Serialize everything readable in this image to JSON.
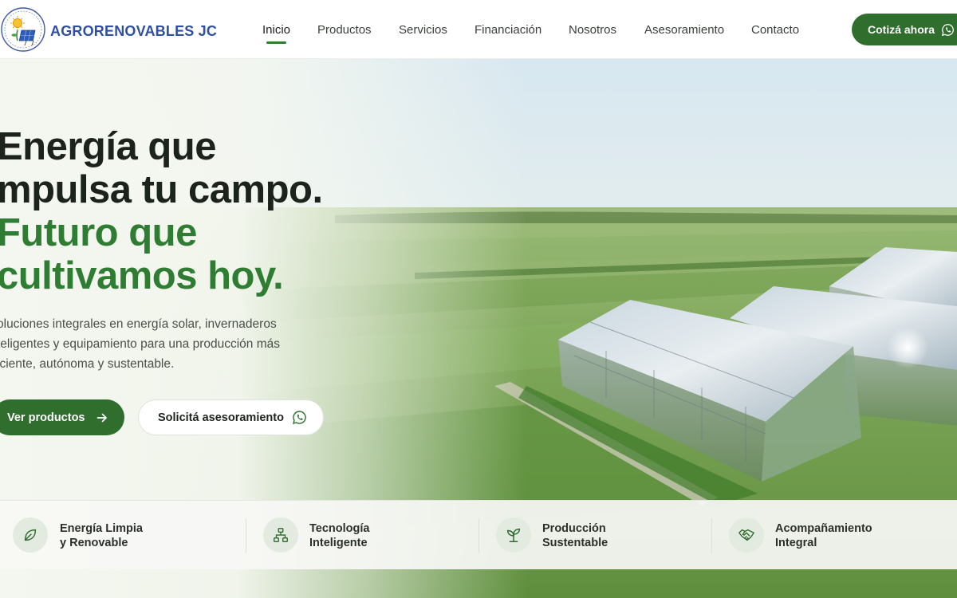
{
  "brand": {
    "name": "AGRORENOVABLES JC"
  },
  "nav": {
    "items": [
      {
        "label": "Inicio",
        "active": true
      },
      {
        "label": "Productos"
      },
      {
        "label": "Servicios"
      },
      {
        "label": "Financiación"
      },
      {
        "label": "Nosotros"
      },
      {
        "label": "Asesoramiento"
      },
      {
        "label": "Contacto"
      }
    ],
    "cta_label": "Cotizá ahora",
    "cta_icon": "whatsapp-icon"
  },
  "hero": {
    "headline_line1": "Energía que",
    "headline_line2": "mpulsa tu campo.",
    "headline_line3": "Futuro que",
    "headline_line4": "cultivamos hoy.",
    "subtext_line1": "oluciones integrales en energía solar, invernaderos",
    "subtext_line2": "teligentes y equipamiento para una producción más",
    "subtext_line3": "iciente, autónoma y sustentable.",
    "primary_button": "Ver productos",
    "primary_icon": "arrow-right-icon",
    "secondary_button": "Solicitá asesoramiento",
    "secondary_icon": "whatsapp-icon"
  },
  "features": [
    {
      "line1": "Energía Limpia",
      "line2": "y Renovable",
      "icon": "leaf-icon"
    },
    {
      "line1": "Tecnología",
      "line2": "Inteligente",
      "icon": "network-icon"
    },
    {
      "line1": "Producción",
      "line2": "Sustentable",
      "icon": "sprout-icon"
    },
    {
      "line1": "Acompañamiento",
      "line2": "Integral",
      "icon": "handshake-icon"
    }
  ],
  "colors": {
    "brand_blue": "#2f4fa3",
    "accent_green": "#2e7d32",
    "button_green": "#2f6e2c",
    "text_dark": "#1c231c"
  }
}
